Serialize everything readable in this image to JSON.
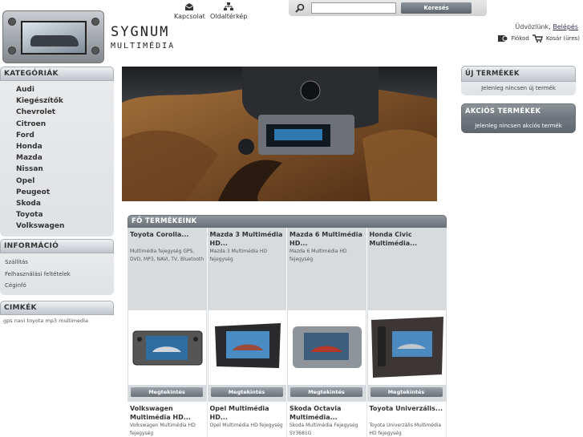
{
  "header": {
    "brand_line1": "SYGNUM",
    "brand_line2": "MULTIMÉDIA",
    "links": [
      {
        "label": "Kapcsolat",
        "icon": "envelope-icon"
      },
      {
        "label": "Oldaltérkép",
        "icon": "sitemap-icon"
      }
    ],
    "search": {
      "placeholder": "",
      "button": "Keresés"
    },
    "welcome_text": "Üdvözlünk,",
    "login_link": "Belépés",
    "account_link": "Fiókod",
    "cart_link": "Kosár (üres)"
  },
  "sidebar": {
    "categories_title": "KATEGÓRIÁK",
    "categories": [
      "Audi",
      "Kiegészítők",
      "Chevrolet",
      "Citroen",
      "Ford",
      "Honda",
      "Mazda",
      "Nissan",
      "Opel",
      "Peugeot",
      "Skoda",
      "Toyota",
      "Volkswagen"
    ],
    "info_title": "INFORMÁCIÓ",
    "info_items": [
      "Szállítás",
      "Felhasználási feltételek",
      "Céginfó"
    ],
    "tags_title": "CIMKÉK",
    "tags_text": "gps navi toyota mp3 multimedia"
  },
  "right": {
    "new_title": "ÚJ TERMÉKEK",
    "new_text": "Jelenleg nincsen új termék",
    "sale_title": "AKCIÓS TERMÉKEK",
    "sale_text": "Jelenleg nincsen akciós termék"
  },
  "products": {
    "title": "FŐ TERMÉKEINK",
    "button_label": "Megtekintés",
    "row1": [
      {
        "name": "Toyota Corolla...",
        "desc": "Multimédia fejegység GPS, DVD, MP3, NAVI, TV, Bluetooth"
      },
      {
        "name": "Mazda 3 Multimédia HD...",
        "desc": "Mazda 3 Multimédia HD fejegység"
      },
      {
        "name": "Mazda 6 Multimédia HD...",
        "desc": "Mazda 6 Multimédia HD fejegység"
      },
      {
        "name": "Honda Civic Multimédia...",
        "desc": ""
      }
    ],
    "row2": [
      {
        "name": "Volkswagen Multimédia HD...",
        "desc": "Volkswagen Multimédia HD fejegység"
      },
      {
        "name": "Opel Multimédia HD...",
        "desc": "Opel Multimédia HD fejegység"
      },
      {
        "name": "Skoda Octavia Multimédia...",
        "desc": "Skoda Multimédia Fejegység SY3681G"
      },
      {
        "name": "Toyota Univerzális...",
        "desc": "Toyota Univerzális Multimédia HD fejegység"
      }
    ]
  }
}
